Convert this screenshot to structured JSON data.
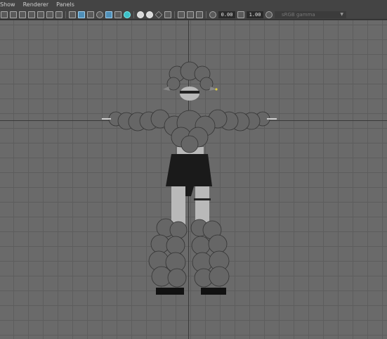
{
  "menubar": {
    "items": [
      "Show",
      "Renderer",
      "Panels"
    ]
  },
  "toolbar": {
    "exposure_value": "0.00",
    "gamma_value": "1.00",
    "color_space": "sRGB gamma"
  },
  "icons": [
    "camera-select-icon",
    "camera-attributes-icon",
    "bookmark-icon",
    "image-plane-icon",
    "grid-icon",
    "film-gate-icon",
    "resolution-gate-icon",
    "wireframe-icon",
    "smooth-shade-icon",
    "default-material-icon",
    "textured-icon",
    "use-all-lights-icon",
    "shadows-icon",
    "ambient-occlusion-icon",
    "motion-blur-icon",
    "anti-alias-icon",
    "isolate-select-icon",
    "xray-icon",
    "xray-joints-icon",
    "xray-components-icon",
    "exposure-icon",
    "gamma-icon",
    "color-management-icon"
  ]
}
